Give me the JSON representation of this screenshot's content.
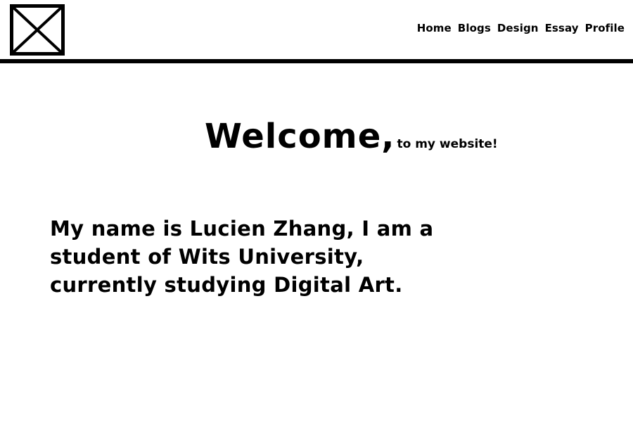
{
  "header": {
    "logo_icon": "placeholder-image-icon",
    "nav": {
      "home": "Home",
      "blogs": "Blogs",
      "design": "Design",
      "essay": "Essay",
      "profile": "Profile"
    }
  },
  "main": {
    "welcome_title": "Welcome,",
    "welcome_subtitle": "to my website!",
    "intro": "My name is Lucien Zhang, I am a student of Wits University, currently studying Digital Art."
  },
  "colors": {
    "background": "#ffffff",
    "text": "#000000",
    "divider": "#000000"
  }
}
